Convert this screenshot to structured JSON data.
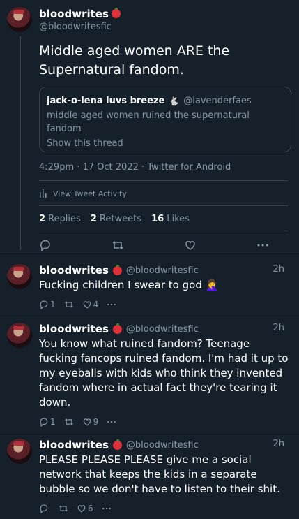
{
  "main_tweet": {
    "display_name": "bloodwrites",
    "handle": "@bloodwritesfic",
    "text": "Middle aged women ARE the Supernatural fandom.",
    "quote": {
      "display_name": "jack-o-lena luvs breeze",
      "handle": "@lavenderfaes",
      "text": "middle aged women ruined the supernatural fandom",
      "show_thread": "Show this thread"
    },
    "meta": "4:29pm · 17 Oct 2022 · Twitter for Android",
    "view_activity": "View Tweet Activity",
    "stats": {
      "replies_count": "2",
      "replies_label": "Replies",
      "retweets_count": "2",
      "retweets_label": "Retweets",
      "likes_count": "16",
      "likes_label": "Likes"
    }
  },
  "replies": [
    {
      "display_name": "bloodwrites",
      "handle": "@bloodwritesfic",
      "time": "2h",
      "text": "Fucking children I swear to god 🤦‍♀️",
      "reply_count": "1",
      "like_count": "4"
    },
    {
      "display_name": "bloodwrites",
      "handle": "@bloodwritesfic",
      "time": "2h",
      "text": "You know what ruined fandom? Teenage fucking fancops ruined fandom. I'm had it up to my eyeballs with kids who think they invented fandom where in actual fact they're tearing it down.",
      "reply_count": "1",
      "like_count": "9"
    },
    {
      "display_name": "bloodwrites",
      "handle": "@bloodwritesfic",
      "time": "2h",
      "text": "PLEASE PLEASE PLEASE give me a social network that keeps the kids in a separate bubble so we don't have to listen to their shit.",
      "reply_count": "",
      "like_count": "6"
    }
  ],
  "colors": {
    "background": "#15202b",
    "muted": "#8899a6",
    "border": "#38444d"
  }
}
